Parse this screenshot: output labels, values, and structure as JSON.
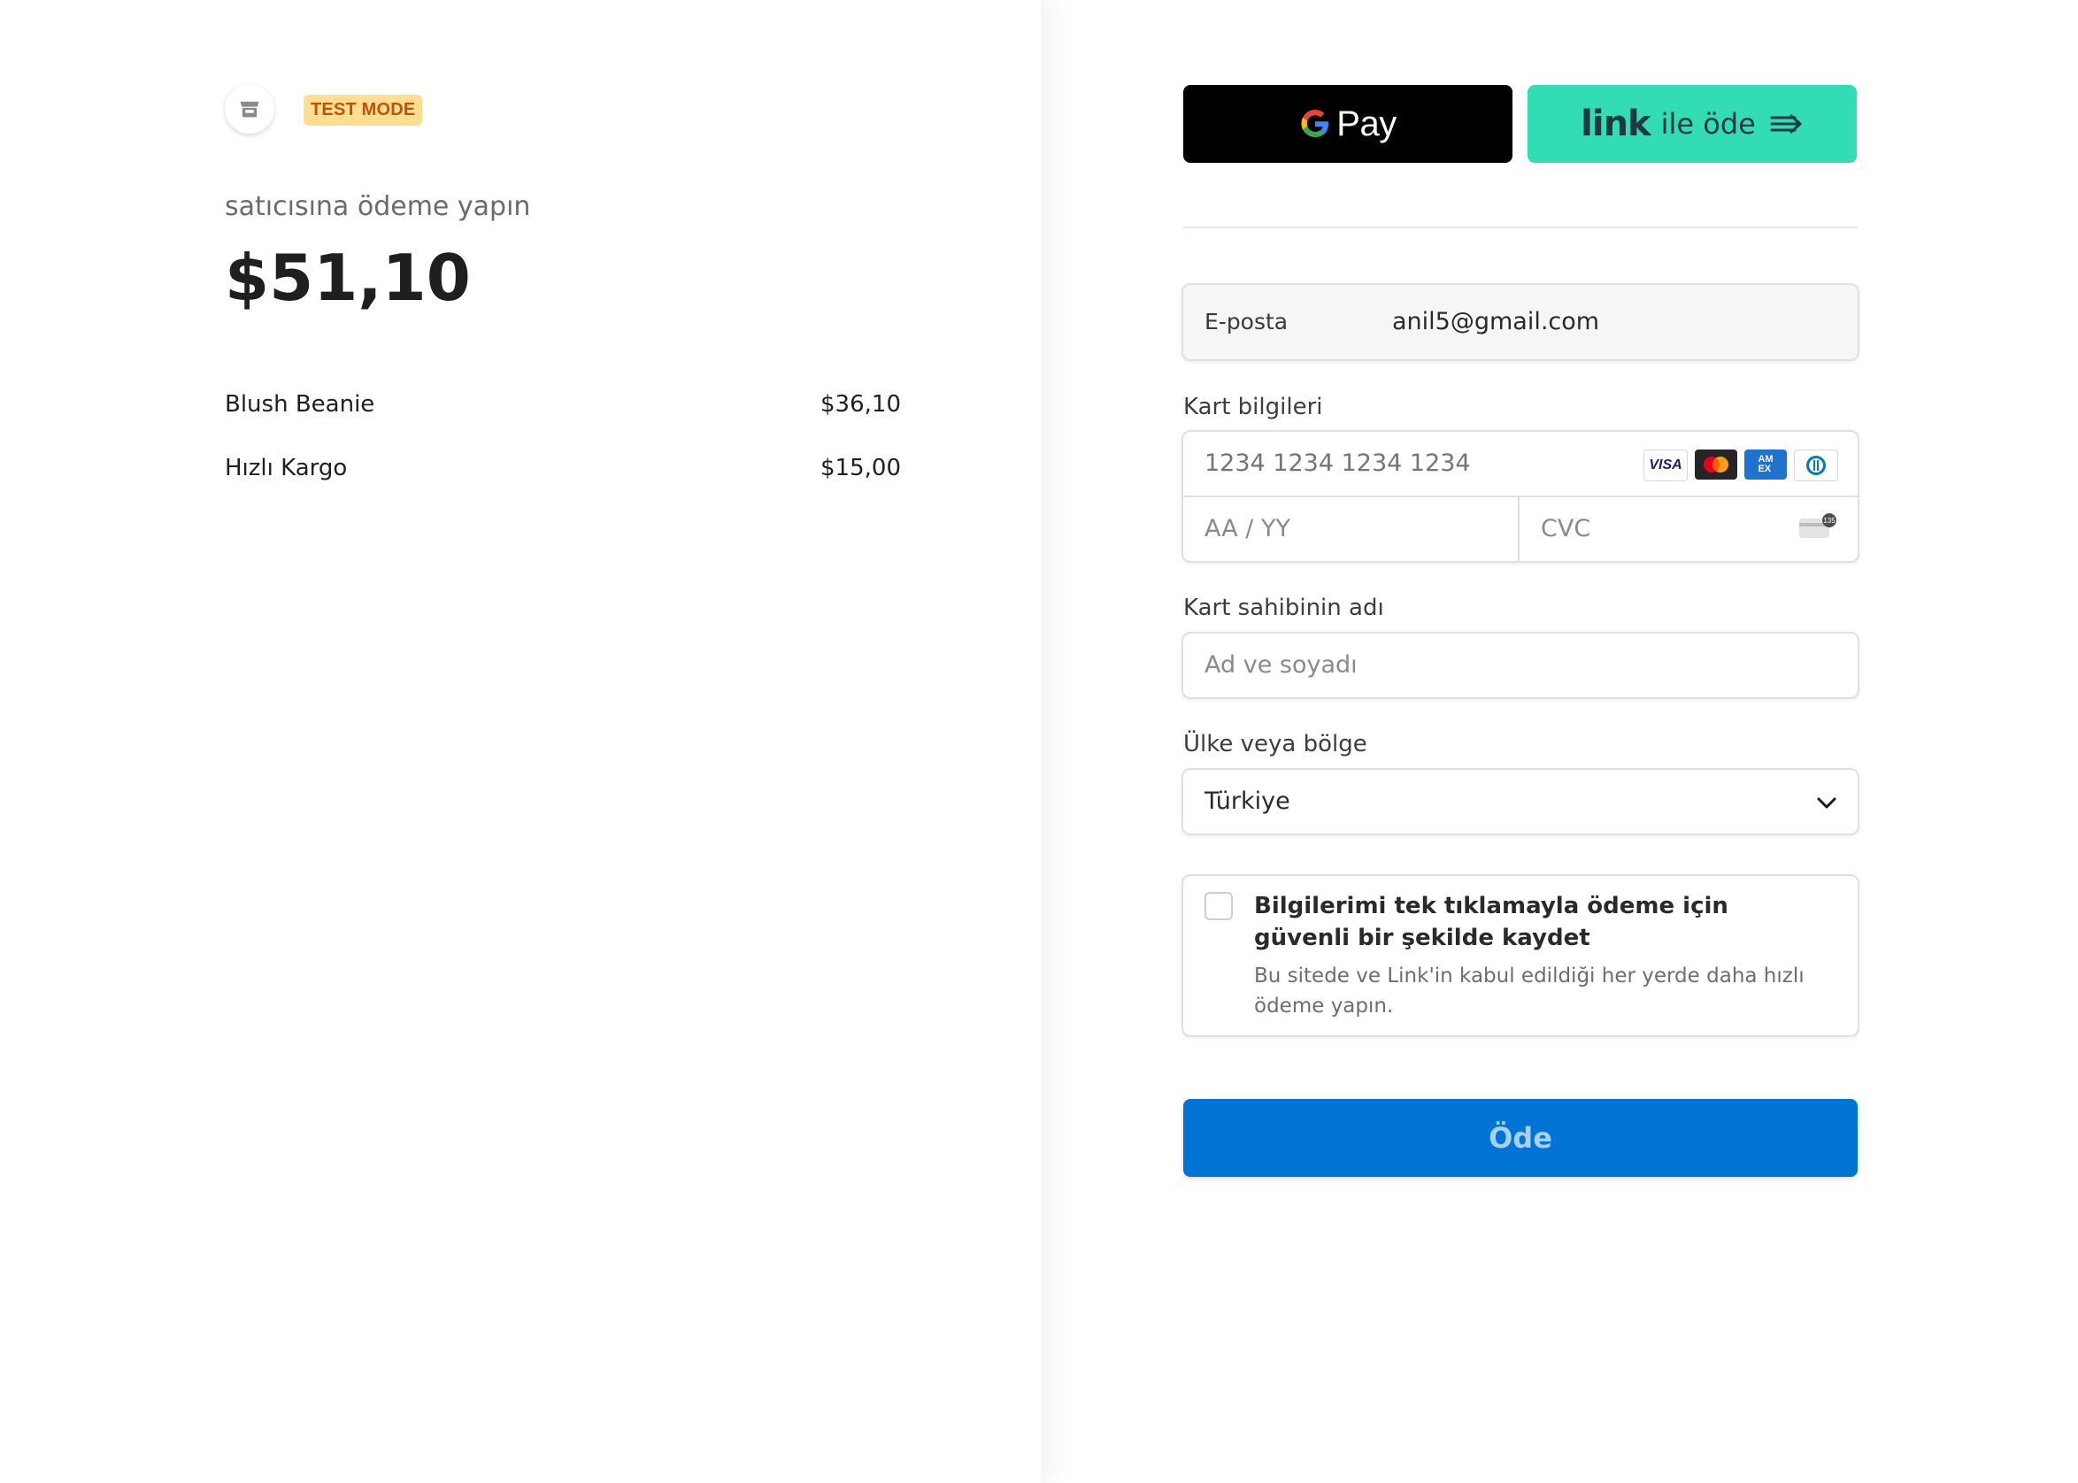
{
  "summary": {
    "badge": "TEST MODE",
    "merchant_line": "satıcısına ödeme yapın",
    "total": "$51,10",
    "items": [
      {
        "name": "Blush Beanie",
        "price": "$36,10"
      },
      {
        "name": "Hızlı Kargo",
        "price": "$15,00"
      }
    ]
  },
  "wallets": {
    "gpay_text": "Pay",
    "link_brand": "link",
    "link_action": "ile öde"
  },
  "email": {
    "label": "E-posta",
    "value": "anil5@gmail.com"
  },
  "card": {
    "label": "Kart bilgileri",
    "number_placeholder": "1234 1234 1234 1234",
    "expiry_placeholder": "AA / YY",
    "cvc_placeholder": "CVC",
    "brands": [
      "VISA",
      "Mastercard",
      "American Express",
      "Diners Club"
    ]
  },
  "cardholder": {
    "label": "Kart sahibinin adı",
    "placeholder": "Ad ve soyadı"
  },
  "country": {
    "label": "Ülke veya bölge",
    "selected": "Türkiye"
  },
  "save_info": {
    "title": "Bilgilerimi tek tıklamayla ödeme için güvenli bir şekilde kaydet",
    "subtitle": "Bu sitede ve Link'in kabul edildiği her yerde daha hızlı ödeme yapın.",
    "checked": false
  },
  "pay_button": {
    "label": "Öde"
  },
  "colors": {
    "pay_button": "#0074d4",
    "link_button": "#33ddb3",
    "test_badge_bg": "#ffde92",
    "test_badge_text": "#bb5504"
  }
}
